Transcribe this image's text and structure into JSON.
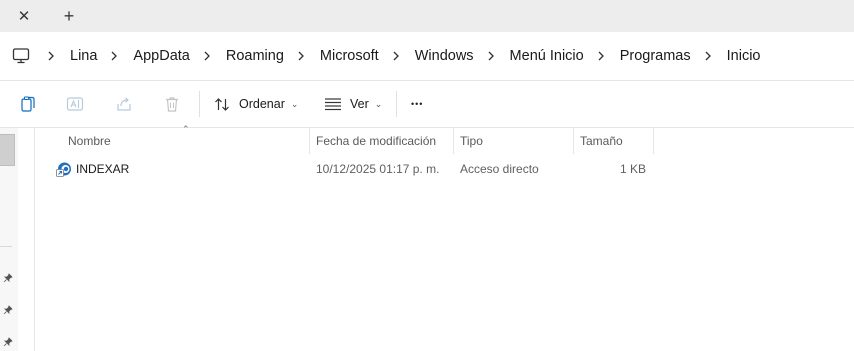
{
  "tabs": {
    "close_glyph": "✕",
    "new_tab_glyph": "+"
  },
  "address": {
    "root_icon": "this-pc-icon",
    "breadcrumbs": [
      "Lina",
      "AppData",
      "Roaming",
      "Microsoft",
      "Windows",
      "Menú Inicio",
      "Programas",
      "Inicio"
    ]
  },
  "toolbar": {
    "icons": [
      "copy-icon",
      "rename-icon",
      "share-icon",
      "delete-icon"
    ],
    "sort_label": "Ordenar",
    "view_label": "Ver",
    "more_glyph": "•••"
  },
  "file_list": {
    "columns": {
      "name": "Nombre",
      "date": "Fecha de modificación",
      "type": "Tipo",
      "size": "Tamaño"
    },
    "sort_indicator": "⌃",
    "rows": [
      {
        "name": "INDEXAR",
        "date": "10/12/2025 01:17 p. m.",
        "type": "Acceso directo",
        "size": "1 KB",
        "icon": "shortcut-app-icon"
      }
    ]
  },
  "colors": {
    "tabstrip_bg": "#ededed",
    "accent": "#0f6cbd"
  }
}
